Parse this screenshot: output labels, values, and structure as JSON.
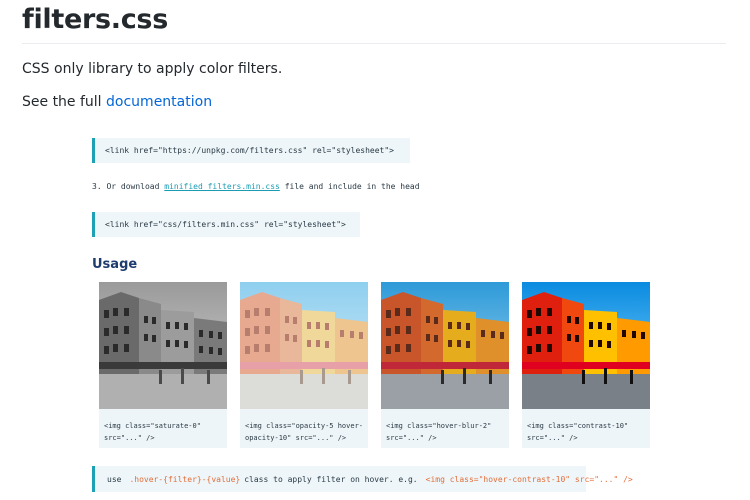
{
  "header": {
    "title": "filters.css",
    "description": "CSS only library to apply color filters.",
    "doc_prefix": "See the full",
    "doc_link": "documentation"
  },
  "install": {
    "cdn_code": "<link href=\"https://unpkg.com/filters.css\" rel=\"stylesheet\">",
    "step_prefix": "3. Or download",
    "step_link": "minified filters.min.css",
    "step_suffix": "file and include in the head",
    "local_code": "<link href=\"css/filters.min.css\" rel=\"stylesheet\">"
  },
  "usage": {
    "heading": "Usage",
    "examples": [
      {
        "line1": "<img class=\"saturate-0\"",
        "line2": "src=\"...\" />",
        "filter": "grayscale"
      },
      {
        "line1": "<img class=\"opacity-5 hover-",
        "line2": "opacity-10\" src=\"...\" />",
        "filter": "faded"
      },
      {
        "line1": "<img class=\"hover-blur-2\"",
        "line2": "src=\"...\" />",
        "filter": "normal"
      },
      {
        "line1": "<img class=\"contrast-10\"",
        "line2": "src=\"...\" />",
        "filter": "high-contrast"
      }
    ],
    "hint_use": "use",
    "hint_class": ".hover-{filter}-{value}",
    "hint_text": "class to apply filter on hover. e.g.",
    "hint_example": "<img class=\"hover-contrast-10\" src=\"...\" />"
  },
  "colors": {
    "link": "#0366d6",
    "accent": "#1ea1b4",
    "heading": "#1f3c6e",
    "highlight": "#e36e3a",
    "code_bg": "#eef6f9"
  }
}
